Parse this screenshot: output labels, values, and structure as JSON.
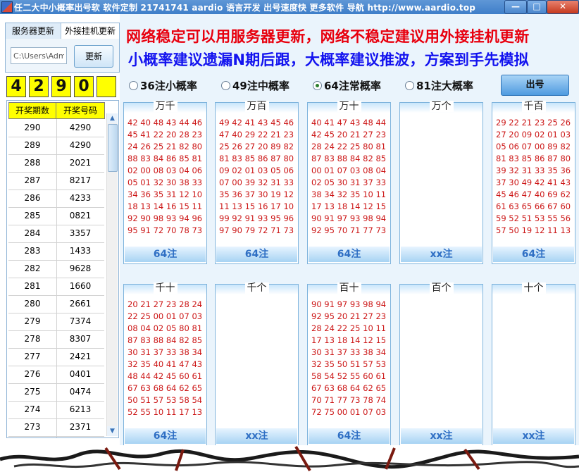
{
  "window": {
    "title": "任二大中小概率出号软  软件定制 21741741 aardio 语言开发 出号速度快 更多软件 导航 http://www.aardio.top",
    "min": "—",
    "max": "□",
    "close": "✕"
  },
  "tabs": [
    "服务器更新",
    "外接挂机更新"
  ],
  "path_value": "C:\\Users\\Adm",
  "update_button": "更新",
  "current_digits": [
    "4",
    "2",
    "9",
    "0",
    ""
  ],
  "history": {
    "headers": [
      "开奖期数",
      "开奖号码"
    ],
    "rows": [
      [
        "290",
        "4290"
      ],
      [
        "289",
        "4290"
      ],
      [
        "288",
        "2021"
      ],
      [
        "287",
        "8217"
      ],
      [
        "286",
        "4233"
      ],
      [
        "285",
        "0821"
      ],
      [
        "284",
        "3357"
      ],
      [
        "283",
        "1433"
      ],
      [
        "282",
        "9628"
      ],
      [
        "281",
        "1660"
      ],
      [
        "280",
        "2661"
      ],
      [
        "279",
        "7374"
      ],
      [
        "278",
        "8307"
      ],
      [
        "277",
        "2421"
      ],
      [
        "276",
        "0401"
      ],
      [
        "275",
        "0474"
      ],
      [
        "274",
        "6213"
      ],
      [
        "273",
        "2371"
      ]
    ],
    "scroll_up": "▲",
    "scroll_down": "▼"
  },
  "banner": {
    "line1": "网络稳定可以用服务器更新，网络不稳定建议用外接挂机更新",
    "line2": "小概率建议遗漏N期后跟，大概率建议推波，方案到手先模拟"
  },
  "options": [
    {
      "label": "36注小概率",
      "selected": false
    },
    {
      "label": "49注中概率",
      "selected": false
    },
    {
      "label": "64注常概率",
      "selected": true
    },
    {
      "label": "81注大概率",
      "selected": false
    }
  ],
  "draw_button": "出号",
  "cards": [
    {
      "label": "万千",
      "lines": [
        "42 40 48 43 44 46",
        "45 41 22 20 28 23",
        "24 26 25 21 82 80",
        "88 83 84 86 85 81",
        "02 00 08 03 04 06",
        "05 01 32 30 38 33",
        "34 36 35 31 12 10",
        "18 13 14 16 15 11",
        "92 90 98 93 94 96",
        "95 91 72 70 78 73"
      ],
      "footer": "64注"
    },
    {
      "label": "万百",
      "lines": [
        "49 42 41 43 45 46",
        "47 40 29 22 21 23",
        "25 26 27 20 89 82",
        "81 83 85 86 87 80",
        "09 02 01 03 05 06",
        "07 00 39 32 31 33",
        "35 36 37 30 19 12",
        "11 13 15 16 17 10",
        "99 92 91 93 95 96",
        "97 90 79 72 71 73"
      ],
      "footer": "64注"
    },
    {
      "label": "万十",
      "lines": [
        "40 41 47 43 48 44",
        "42 45 20 21 27 23",
        "28 24 22 25 80 81",
        "87 83 88 84 82 85",
        "00 01 07 03 08 04",
        "02 05 30 31 37 33",
        "38 34 32 35 10 11",
        "17 13 18 14 12 15",
        "90 91 97 93 98 94",
        "92 95 70 71 77 73"
      ],
      "footer": "64注"
    },
    {
      "label": "万个",
      "lines": [],
      "footer": "xx注"
    },
    {
      "label": "千百",
      "lines": [
        "29 22 21 23 25 26",
        "27 20 09 02 01 03",
        "05 06 07 00 89 82",
        "81 83 85 86 87 80",
        "39 32 31 33 35 36",
        "37 30 49 42 41 43",
        "45 46 47 40 69 62",
        "61 63 65 66 67 60",
        "59 52 51 53 55 56",
        "57 50 19 12 11 13"
      ],
      "footer": "64注"
    },
    {
      "label": "千十",
      "lines": [
        "20 21 27 23 28 24",
        "22 25 00 01 07 03",
        "08 04 02 05 80 81",
        "87 83 88 84 82 85",
        "30 31 37 33 38 34",
        "32 35 40 41 47 43",
        "48 44 42 45 60 61",
        "67 63 68 64 62 65",
        "50 51 57 53 58 54",
        "52 55 10 11 17 13"
      ],
      "footer": "64注"
    },
    {
      "label": "千个",
      "lines": [],
      "footer": "xx注"
    },
    {
      "label": "百十",
      "lines": [
        "90 91 97 93 98 94",
        "92 95 20 21 27 23",
        "28 24 22 25 10 11",
        "17 13 18 14 12 15",
        "30 31 37 33 38 34",
        "32 35 50 51 57 53",
        "58 54 52 55 60 61",
        "67 63 68 64 62 65",
        "70 71 77 73 78 74",
        "72 75 00 01 07 03"
      ],
      "footer": "64注"
    },
    {
      "label": "百个",
      "lines": [],
      "footer": "xx注"
    },
    {
      "label": "十个",
      "lines": [],
      "footer": "xx注"
    }
  ]
}
